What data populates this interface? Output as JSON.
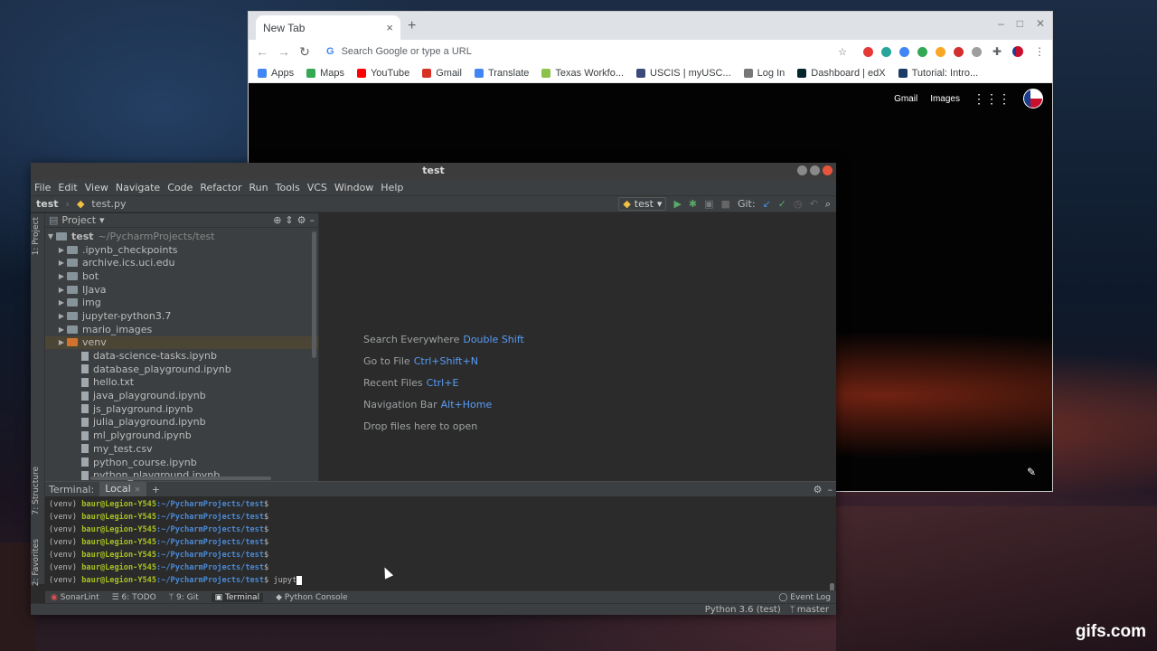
{
  "chrome": {
    "tab_title": "New Tab",
    "tab_close": "×",
    "new_tab": "+",
    "omnibox_placeholder": "Search Google or type a URL",
    "bookmarks": [
      {
        "label": "Apps",
        "color": "#4285f4"
      },
      {
        "label": "Maps",
        "color": "#34a853"
      },
      {
        "label": "YouTube",
        "color": "#ff0000"
      },
      {
        "label": "Gmail",
        "color": "#d93025"
      },
      {
        "label": "Translate",
        "color": "#4285f4"
      },
      {
        "label": "Texas Workfo...",
        "color": "#8bc34a"
      },
      {
        "label": "USCIS | myUSC...",
        "color": "#3a4a7a"
      },
      {
        "label": "Log In",
        "color": "#777777"
      },
      {
        "label": "Dashboard | edX",
        "color": "#02262b"
      },
      {
        "label": "Tutorial: Intro...",
        "color": "#1b3a66"
      }
    ],
    "extension_colors": [
      "#e53935",
      "#26a69a",
      "#4285f4",
      "#34a853",
      "#f9a825",
      "#d32f2f",
      "#9e9e9e"
    ],
    "page_links": {
      "gmail": "Gmail",
      "images": "Images"
    }
  },
  "ide": {
    "title": "test",
    "menu": [
      "File",
      "Edit",
      "View",
      "Navigate",
      "Code",
      "Refactor",
      "Run",
      "Tools",
      "VCS",
      "Window",
      "Help"
    ],
    "breadcrumb": {
      "root": "test",
      "file": "test.py"
    },
    "run_config": "test",
    "git_label": "Git:",
    "project_panel": {
      "title": "Project",
      "root_name": "test",
      "root_path": "~/PycharmProjects/test",
      "folders": [
        ".ipynb_checkpoints",
        "archive.ics.uci.edu",
        "bot",
        "IJava",
        "img",
        "jupyter-python3.7",
        "mario_images",
        "venv"
      ],
      "selected_folder": "venv",
      "files": [
        "data-science-tasks.ipynb",
        "database_playground.ipynb",
        "hello.txt",
        "java_playground.ipynb",
        "js_playground.ipynb",
        "julia_playground.ipynb",
        "ml_plyground.ipynb",
        "my_test.csv",
        "python_course.ipynb",
        "python_playground.ipynb"
      ]
    },
    "side_labels": {
      "project": "1: Project",
      "structure": "7: Structure",
      "favorites": "2: Favorites"
    },
    "hints": [
      {
        "label": "Search Everywhere",
        "key": "Double Shift"
      },
      {
        "label": "Go to File",
        "key": "Ctrl+Shift+N"
      },
      {
        "label": "Recent Files",
        "key": "Ctrl+E"
      },
      {
        "label": "Navigation Bar",
        "key": "Alt+Home"
      },
      {
        "label": "Drop files here to open",
        "key": ""
      }
    ],
    "terminal": {
      "label": "Terminal:",
      "tab": "Local",
      "prompt_env": "(venv)",
      "prompt_user": "baur@Legion-Y545",
      "prompt_path": ":~/PycharmProjects/test",
      "prompt_end": "$",
      "empty_lines": 6,
      "typed": "jupyt"
    },
    "bottom_tabs": [
      "SonarLint",
      "6: TODO",
      "9: Git",
      "Terminal",
      "Python Console"
    ],
    "active_bottom_tab": "Terminal",
    "event_log": "Event Log",
    "status": {
      "interpreter": "Python 3.6 (test)",
      "branch": "master"
    }
  },
  "watermark": "gifs.com"
}
